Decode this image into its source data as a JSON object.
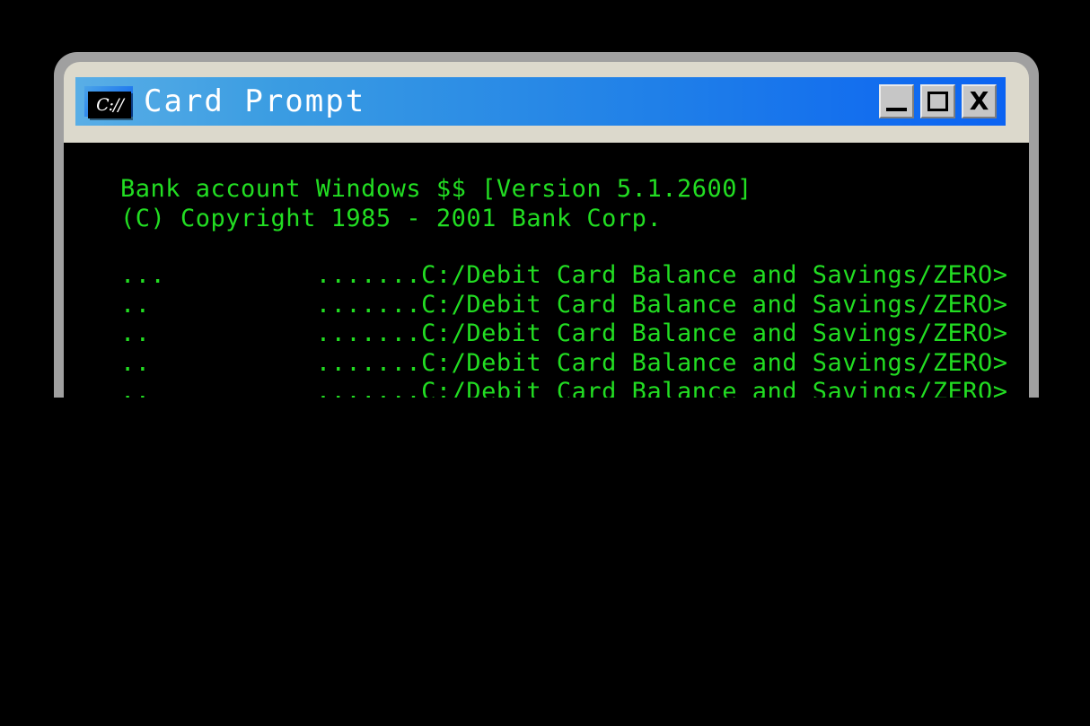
{
  "window": {
    "title": "Card Prompt",
    "icon_name": "command-prompt-icon",
    "icon_label": "C://",
    "controls": {
      "minimize_label": "_",
      "maximize_label": "□",
      "close_label": "X"
    },
    "colors": {
      "titlebar_gradient_start": "#59aee6",
      "titlebar_gradient_end": "#0b63f2",
      "outer_bezel": "#a0a0a0",
      "inner_bezel": "#dcd9cc",
      "terminal_background": "#000000",
      "terminal_text": "#22dd22",
      "title_text": "#ffffff",
      "button_face": "#c6c6c6"
    }
  },
  "terminal": {
    "header_lines": [
      "Bank account Windows $$ [Version 5.1.2600]",
      "(C) Copyright 1985 - 2001 Bank Corp."
    ],
    "prompt_lines": [
      "...          .......C:/Debit Card Balance and Savings/ZERO>",
      "..           .......C:/Debit Card Balance and Savings/ZERO>",
      "..           .......C:/Debit Card Balance and Savings/ZERO>",
      "..           .......C:/Debit Card Balance and Savings/ZERO>",
      "..           .......C:/Debit Card Balance and Savings/ZERO>"
    ]
  }
}
